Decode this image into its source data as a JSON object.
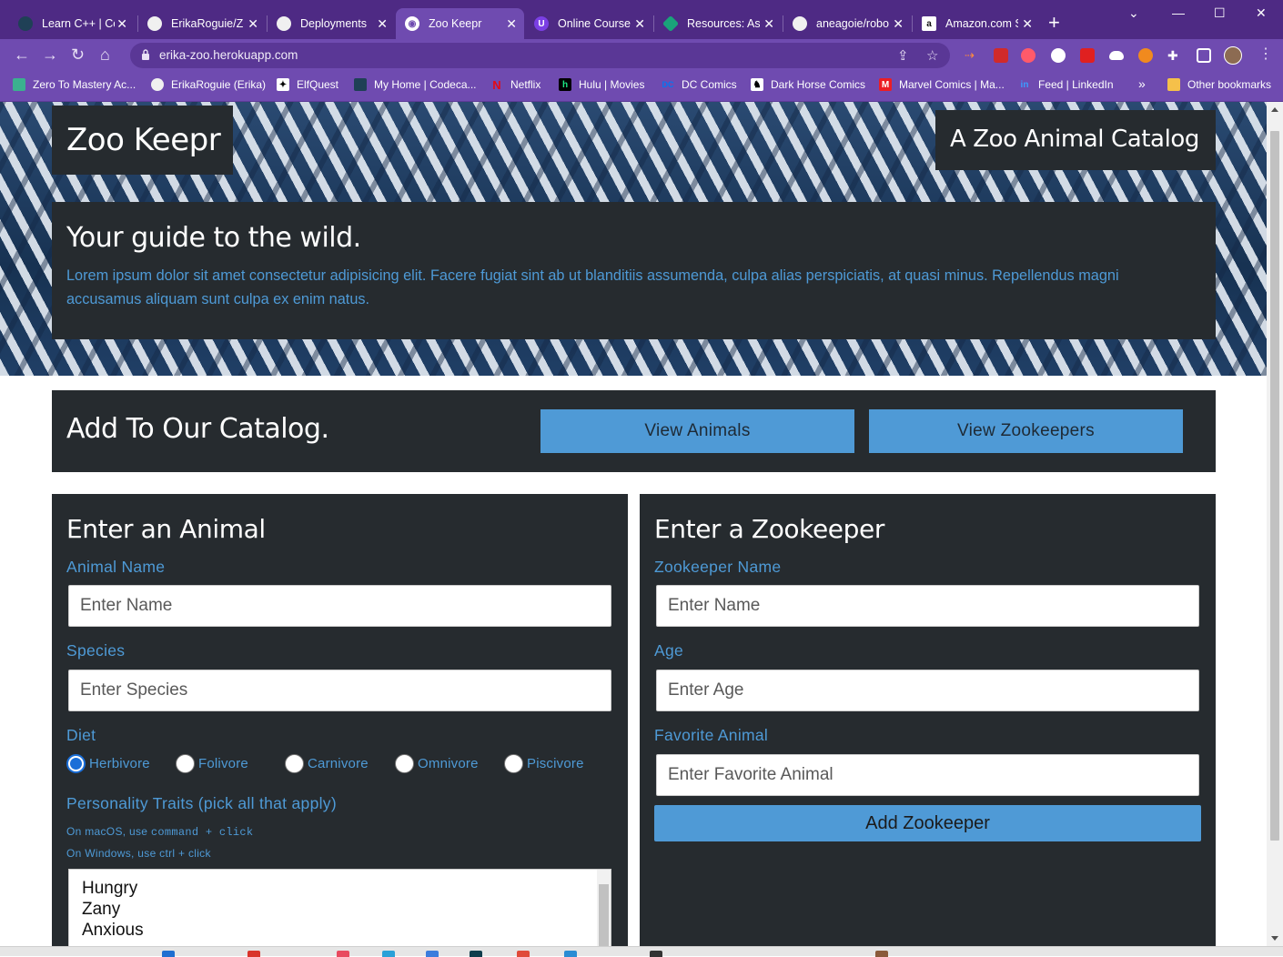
{
  "browser": {
    "tabs": [
      {
        "label": "Learn C++ | Co",
        "icon": "codecademy-icon",
        "icon_color": "#1f4056"
      },
      {
        "label": "ErikaRoguie/Z",
        "icon": "github-icon",
        "icon_color": "#24292f"
      },
      {
        "label": "Deployments",
        "icon": "github-icon",
        "icon_color": "#24292f"
      },
      {
        "label": "Zoo Keepr",
        "icon": "globe-icon",
        "icon_color": "#ffffff"
      },
      {
        "label": "Online Course",
        "icon": "course-icon",
        "icon_color": "#7b3fe4"
      },
      {
        "label": "Resources: Asy",
        "icon": "resources-icon",
        "icon_color": "#1aa37a"
      },
      {
        "label": "aneagoie/robo",
        "icon": "github-icon",
        "icon_color": "#24292f"
      },
      {
        "label": "Amazon.com S",
        "icon": "amazon-icon",
        "icon_color": "#ffffff"
      }
    ],
    "active_tab_index": 3,
    "new_tab_label": "+",
    "url": "erika-zoo.herokuapp.com",
    "bookmarks": [
      {
        "label": "Zero To Mastery Ac...",
        "icon": "ztm-icon",
        "color": "#3bb08f"
      },
      {
        "label": "ErikaRoguie (Erika)",
        "icon": "github-icon",
        "color": "#24292f"
      },
      {
        "label": "ElfQuest",
        "icon": "elfquest-icon",
        "color": "#000000"
      },
      {
        "label": "My Home | Codeca...",
        "icon": "codecademy-icon",
        "color": "#1f4056"
      },
      {
        "label": "Netflix",
        "icon": "netflix-icon",
        "color": "#e50914"
      },
      {
        "label": "Hulu | Movies",
        "icon": "hulu-icon",
        "color": "#1ce783"
      },
      {
        "label": "DC Comics",
        "icon": "dc-icon",
        "color": "#0476f2"
      },
      {
        "label": "Dark Horse Comics",
        "icon": "darkhorse-icon",
        "color": "#000000"
      },
      {
        "label": "Marvel Comics | Ma...",
        "icon": "marvel-icon",
        "color": "#ec1d24"
      },
      {
        "label": "Feed | LinkedIn",
        "icon": "linkedin-icon",
        "color": "#0a66c2"
      }
    ],
    "bookmarks_more": "»",
    "other_bookmarks": "Other bookmarks"
  },
  "page": {
    "brand": "Zoo Keepr",
    "tagline": "A Zoo Animal Catalog",
    "intro_heading": "Your guide to the wild.",
    "intro_text": "Lorem ipsum dolor sit amet consectetur adipisicing elit. Facere fugiat sint ab ut blanditiis assumenda, culpa alias perspiciatis, at quasi minus. Repellendus magni accusamus aliquam sunt culpa ex enim natus.",
    "catalog_heading": "Add To Our Catalog.",
    "view_animals": "View Animals",
    "view_zookeepers": "View Zookeepers",
    "accent_color": "#4f9ad6",
    "panel_color": "#262b2f"
  },
  "animal_form": {
    "heading": "Enter an Animal",
    "name_label": "Animal Name",
    "name_placeholder": "Enter Name",
    "species_label": "Species",
    "species_placeholder": "Enter Species",
    "diet_label": "Diet",
    "diet_options": [
      "Herbivore",
      "Folivore",
      "Carnivore",
      "Omnivore",
      "Piscivore"
    ],
    "diet_selected": "Herbivore",
    "traits_label": "Personality Traits (pick all that apply)",
    "hint_mac_prefix": "On macOS, use",
    "hint_mac_code": "command + click",
    "hint_windows": "On Windows, use ctrl + click",
    "traits_options": [
      "Hungry",
      "Zany",
      "Anxious"
    ]
  },
  "zookeeper_form": {
    "heading": "Enter a Zookeeper",
    "name_label": "Zookeeper Name",
    "name_placeholder": "Enter Name",
    "age_label": "Age",
    "age_placeholder": "Enter Age",
    "fav_label": "Favorite Animal",
    "fav_placeholder": "Enter Favorite Animal",
    "submit": "Add Zookeeper"
  }
}
